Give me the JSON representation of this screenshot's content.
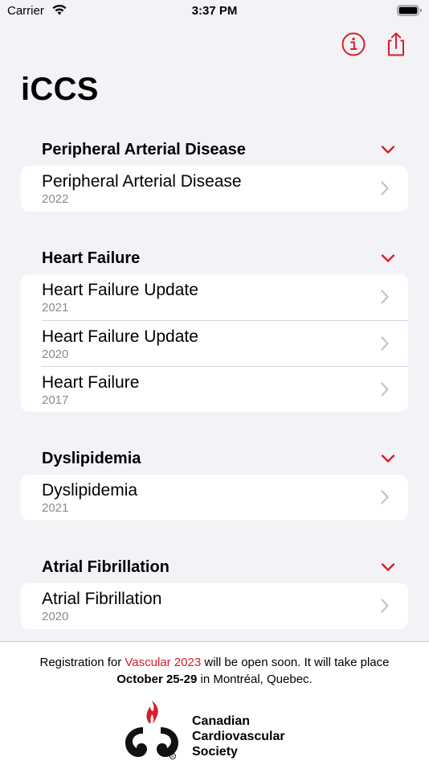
{
  "status": {
    "carrier": "Carrier",
    "time": "3:37 PM"
  },
  "nav": {
    "title": "iCCS",
    "info_icon": "info-circle-icon",
    "share_icon": "share-icon"
  },
  "accent_color": "#d81e28",
  "sections": [
    {
      "title": "Peripheral Arterial Disease",
      "items": [
        {
          "title": "Peripheral Arterial Disease",
          "year": "2022"
        }
      ]
    },
    {
      "title": "Heart Failure",
      "items": [
        {
          "title": "Heart Failure Update",
          "year": "2021"
        },
        {
          "title": "Heart Failure Update",
          "year": "2020"
        },
        {
          "title": "Heart Failure",
          "year": "2017"
        }
      ]
    },
    {
      "title": "Dyslipidemia",
      "items": [
        {
          "title": "Dyslipidemia",
          "year": "2021"
        }
      ]
    },
    {
      "title": "Atrial Fibrillation",
      "items": [
        {
          "title": "Atrial Fibrillation",
          "year": "2020"
        }
      ]
    }
  ],
  "footer": {
    "text_1": "Registration for ",
    "link": "Vascular 2023",
    "text_2": " will be open soon. It will take place",
    "dates": "October 25-29",
    "text_3": " in Montréal, Quebec.",
    "org_line_1": "Canadian",
    "org_line_2": "Cardiovascular",
    "org_line_3": "Society"
  }
}
